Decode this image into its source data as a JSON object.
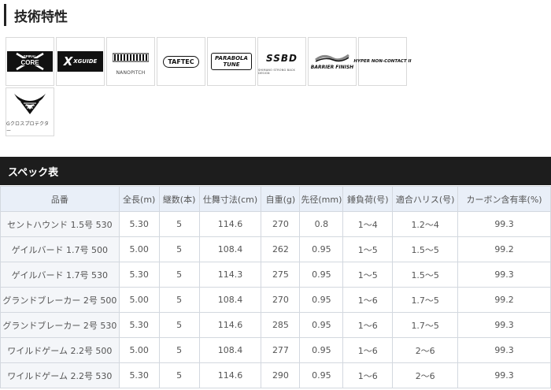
{
  "section": {
    "title": "技術特性"
  },
  "tech_icons": [
    {
      "id": "spiral-core",
      "label_top": "SPIRAL",
      "label": "CORE"
    },
    {
      "id": "x-guide",
      "label": "XGUIDE"
    },
    {
      "id": "nanopitch",
      "caption": "NANOPITCH"
    },
    {
      "id": "taftec",
      "label": "TAFTEC"
    },
    {
      "id": "parabola-tune",
      "label": "PARABOLA",
      "label2": "TUNE"
    },
    {
      "id": "ssbd",
      "label": "SSBD",
      "caption": "SHIMANO STRONG BACK DESIGN"
    },
    {
      "id": "barrier-finish",
      "label": "BARRIER FINISH"
    },
    {
      "id": "hyper-non-contact",
      "label": "HYPER NON-CONTACT II"
    },
    {
      "id": "g-cross-protector",
      "caption": "Gクロスプロテクター"
    }
  ],
  "spec": {
    "title": "スペック表",
    "columns": [
      "品番",
      "全長(m)",
      "継数(本)",
      "仕舞寸法(cm)",
      "自重(g)",
      "先径(mm)",
      "錘負荷(号)",
      "適合ハリス(号)",
      "カーボン含有率(%)"
    ],
    "rows": [
      [
        "セントハウンド 1.5号 530",
        "5.30",
        "5",
        "114.6",
        "270",
        "0.8",
        "1〜4",
        "1.2〜4",
        "99.3"
      ],
      [
        "ゲイルバード 1.7号 500",
        "5.00",
        "5",
        "108.4",
        "262",
        "0.95",
        "1〜5",
        "1.5〜5",
        "99.2"
      ],
      [
        "ゲイルバード 1.7号 530",
        "5.30",
        "5",
        "114.3",
        "275",
        "0.95",
        "1〜5",
        "1.5〜5",
        "99.3"
      ],
      [
        "グランドブレーカー 2号 500",
        "5.00",
        "5",
        "108.4",
        "270",
        "0.95",
        "1〜6",
        "1.7〜5",
        "99.2"
      ],
      [
        "グランドブレーカー 2号 530",
        "5.30",
        "5",
        "114.6",
        "285",
        "0.95",
        "1〜6",
        "1.7〜5",
        "99.3"
      ],
      [
        "ワイルドゲーム 2.2号 500",
        "5.00",
        "5",
        "108.4",
        "277",
        "0.95",
        "1〜6",
        "2〜6",
        "99.3"
      ],
      [
        "ワイルドゲーム 2.2号 530",
        "5.30",
        "5",
        "114.6",
        "290",
        "0.95",
        "1〜6",
        "2〜6",
        "99.3"
      ]
    ]
  }
}
